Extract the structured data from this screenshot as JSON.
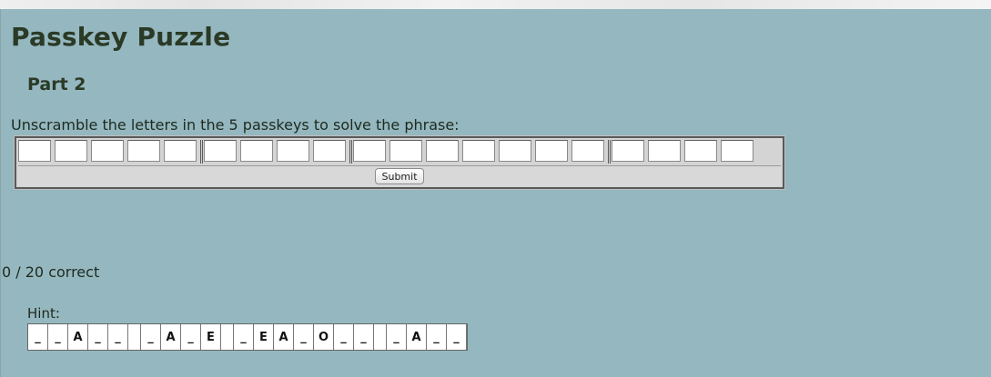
{
  "page": {
    "title": "Passkey Puzzle",
    "subtitle": "Part 2",
    "instructions": "Unscramble the letters in the 5 passkeys to solve the phrase:"
  },
  "puzzle": {
    "groups": [
      5,
      4,
      7,
      4
    ],
    "submit_label": "Submit"
  },
  "score": {
    "text": "0 / 20 correct"
  },
  "hint": {
    "label": "Hint:",
    "groups": [
      [
        "_",
        "_",
        "A",
        "_",
        "_"
      ],
      [
        "_",
        "A",
        "_",
        "E"
      ],
      [
        "_",
        "E",
        "A",
        "_",
        "O",
        "_",
        "_"
      ],
      [
        "_",
        "A",
        "_",
        "_"
      ]
    ]
  },
  "colors": {
    "background": "#95b7bf",
    "title": "#2a3a26"
  }
}
